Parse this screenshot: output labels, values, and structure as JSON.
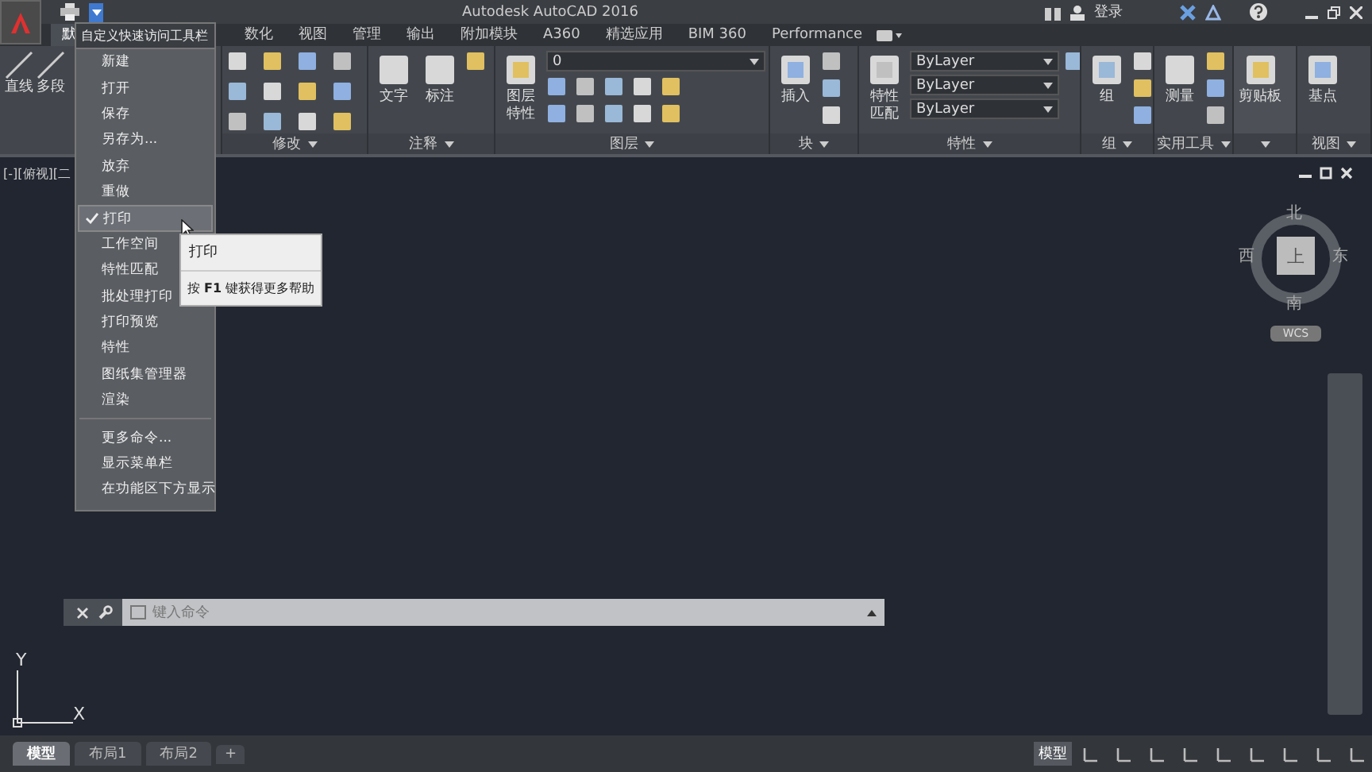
{
  "window": {
    "title": "Autodesk AutoCAD 2016",
    "signin": "登录"
  },
  "tabs": [
    {
      "label": "默",
      "selected": true
    },
    {
      "label": "数化",
      "selected": false
    },
    {
      "label": "视图",
      "selected": false
    },
    {
      "label": "管理",
      "selected": false
    },
    {
      "label": "输出",
      "selected": false
    },
    {
      "label": "附加模块",
      "selected": false
    },
    {
      "label": "A360",
      "selected": false
    },
    {
      "label": "精选应用",
      "selected": false
    },
    {
      "label": "BIM 360",
      "selected": false
    },
    {
      "label": "Performance",
      "selected": false
    }
  ],
  "ribbon": {
    "draw_tools": [
      "直线",
      "多段"
    ],
    "panels": [
      {
        "title": "修改"
      },
      {
        "title": "注释",
        "large": [
          "文字",
          "标注"
        ]
      },
      {
        "title": "图层",
        "large": [
          "图层特性"
        ],
        "dropdowns": [
          "0"
        ]
      },
      {
        "title": "块",
        "large": [
          "插入"
        ]
      },
      {
        "title": "特性",
        "large": [
          "特性匹配"
        ],
        "dropdowns": [
          "ByLayer",
          "ByLayer",
          "ByLayer"
        ]
      },
      {
        "title": "组",
        "large": [
          "组"
        ]
      },
      {
        "title": "实用工具",
        "large": [
          "测量"
        ]
      },
      {
        "large": [
          "剪贴板"
        ]
      },
      {
        "title": "视图",
        "large": [
          "基点"
        ]
      }
    ]
  },
  "quick_access_menu": {
    "header": "自定义快速访问工具栏",
    "items": [
      {
        "label": "新建",
        "checked": false,
        "selected": false
      },
      {
        "label": "打开",
        "checked": false,
        "selected": false
      },
      {
        "label": "保存",
        "checked": false,
        "selected": false
      },
      {
        "label": "另存为...",
        "checked": false,
        "selected": false
      },
      {
        "label": "放弃",
        "checked": false,
        "selected": false
      },
      {
        "label": "重做",
        "checked": false,
        "selected": false
      },
      {
        "label": "打印",
        "checked": true,
        "selected": true
      },
      {
        "label": "工作空间",
        "checked": false,
        "selected": false
      },
      {
        "label": "特性匹配",
        "checked": false,
        "selected": false
      },
      {
        "label": "批处理打印",
        "checked": false,
        "selected": false
      },
      {
        "label": "打印预览",
        "checked": false,
        "selected": false
      },
      {
        "label": "特性",
        "checked": false,
        "selected": false
      },
      {
        "label": "图纸集管理器",
        "checked": false,
        "selected": false
      },
      {
        "label": "渲染",
        "checked": false,
        "selected": false
      }
    ],
    "more_items": [
      "更多命令...",
      "显示菜单栏",
      "在功能区下方显示"
    ]
  },
  "tooltip": {
    "title": "打印",
    "help": "按 **F1** 键获得更多帮助"
  },
  "viewport": {
    "label": "[-][俯视][二",
    "compass": {
      "north": "北",
      "south": "南",
      "east": "东",
      "west": "西",
      "top": "上",
      "ucs": "WCS"
    },
    "ucs_y": "Y",
    "ucs_x": "X"
  },
  "command_line": {
    "placeholder": "键入命令"
  },
  "layout_tabs": [
    {
      "label": "模型",
      "selected": true
    },
    {
      "label": "布局1",
      "selected": false
    },
    {
      "label": "布局2",
      "selected": false
    }
  ],
  "add_tab": "+",
  "status_bar": {
    "mode": "模型"
  }
}
